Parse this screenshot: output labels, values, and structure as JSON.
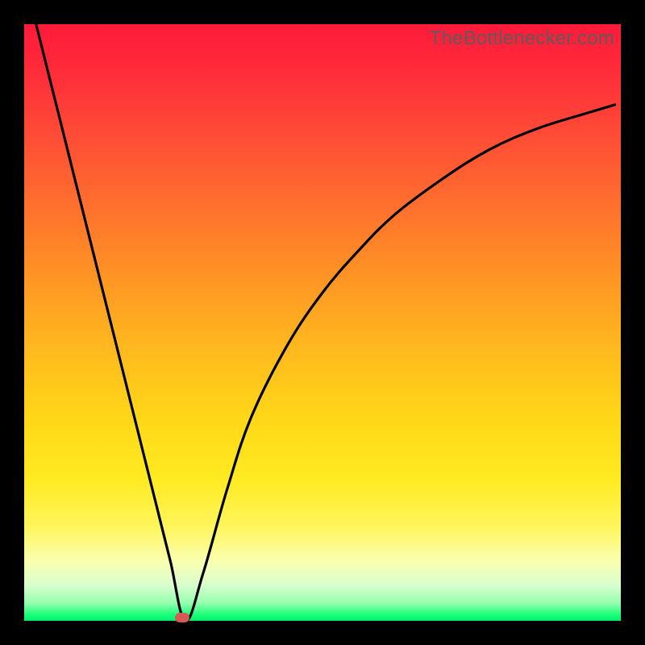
{
  "watermark": "TheBottlenecker.com",
  "colors": {
    "frame": "#000000",
    "gradient_top": "#ff1a3a",
    "gradient_bottom": "#00ef6a",
    "curve": "#000000",
    "marker": "#d65a54"
  },
  "chart_data": {
    "type": "line",
    "title": "",
    "xlabel": "",
    "ylabel": "",
    "xlim": [
      0,
      100
    ],
    "ylim": [
      0,
      100
    ],
    "series": [
      {
        "name": "bottleneck-curve",
        "x": [
          2,
          6,
          10,
          14,
          18,
          22,
          24.5,
          27,
          30,
          34,
          38,
          44,
          50,
          56,
          62,
          70,
          78,
          86,
          94,
          99
        ],
        "y": [
          100,
          84,
          68,
          52,
          36,
          20,
          10,
          0,
          8,
          22,
          34,
          46,
          55,
          62,
          68,
          74,
          79,
          82.5,
          85,
          86.5
        ]
      }
    ],
    "marker": {
      "x": 26.5,
      "y": 0.5
    },
    "annotations": [
      {
        "text": "TheBottlenecker.com",
        "role": "watermark",
        "position": "top-right"
      }
    ]
  }
}
